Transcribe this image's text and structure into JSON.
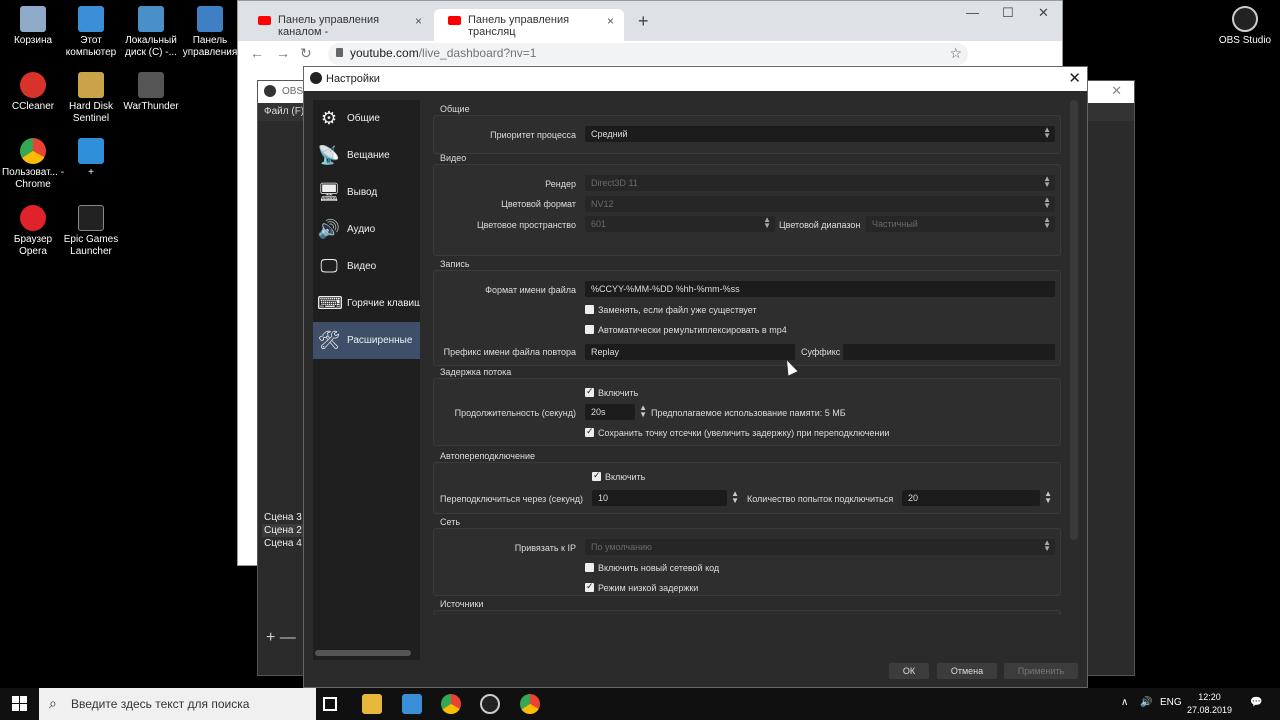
{
  "desktop": {
    "icons_left": [
      {
        "label": "Корзина",
        "color": "#8fa9c9"
      },
      {
        "label": "Этот компьютер",
        "color": "#3b8fd8"
      },
      {
        "label": "Локальный диск (C) -...",
        "color": "#4a90c8"
      },
      {
        "label": "Панель управления",
        "color": "#3f7fc4"
      },
      {
        "label": "CCleaner",
        "color": "#d8332a"
      },
      {
        "label": "Hard Disk Sentinel",
        "color": "#c9a24a"
      },
      {
        "label": "WarThunder",
        "color": "#555555"
      },
      {
        "label": "Пользоват... - Chrome",
        "color": "#4caf50"
      },
      {
        "label": "+",
        "color": "#2f8fd8"
      },
      {
        "label": "Браузер Opera",
        "color": "#e0222a"
      },
      {
        "label": "Epic Games Launcher",
        "color": "#222222"
      }
    ],
    "icon_right": {
      "label": "OBS Studio"
    }
  },
  "chrome": {
    "tabs": [
      {
        "title": "Панель управления каналом - ",
        "close": "×"
      },
      {
        "title": "Панель управления трансляц",
        "close": "×"
      }
    ],
    "new_tab": "+",
    "url_host": "youtube.com",
    "url_path": "/live_dashboard?nv=1",
    "min": "—",
    "max": "☐",
    "close": "✕"
  },
  "obs_main": {
    "title": "OBS",
    "menu": "Файл (F)",
    "scenes": [
      "Сцена 3",
      "Сцена 2",
      "Сцена 4"
    ],
    "add": "+ —"
  },
  "settings": {
    "title": "Настройки",
    "sidebar": [
      {
        "label": "Общие",
        "icon": "gear-icon",
        "glyph": "⚙"
      },
      {
        "label": "Вещание",
        "icon": "broadcast-icon",
        "glyph": "📡"
      },
      {
        "label": "Вывод",
        "icon": "output-icon",
        "glyph": "🖥"
      },
      {
        "label": "Аудио",
        "icon": "speaker-icon",
        "glyph": "🔊"
      },
      {
        "label": "Видео",
        "icon": "monitor-icon",
        "glyph": "🖵"
      },
      {
        "label": "Горячие клавиши",
        "icon": "keyboard-icon",
        "glyph": "⌨"
      },
      {
        "label": "Расширенные",
        "icon": "tools-icon",
        "glyph": "🛠"
      }
    ],
    "general": {
      "title": "Общие",
      "priority_label": "Приоритет процесса",
      "priority_value": "Средний"
    },
    "video": {
      "title": "Видео",
      "renderer_label": "Рендер",
      "renderer_value": "Direct3D 11",
      "color_format_label": "Цветовой формат",
      "color_format_value": "NV12",
      "color_space_label": "Цветовое пространство",
      "color_space_value": "601",
      "color_range_label": "Цветовой диапазон",
      "color_range_value": "Частичный"
    },
    "recording": {
      "title": "Запись",
      "filename_label": "Формат имени файла",
      "filename_value": "%CCYY-%MM-%DD %hh-%mm-%ss",
      "overwrite_label": "Заменять, если файл уже существует",
      "remux_label": "Автоматически ремультиплексировать в mp4",
      "replay_prefix_label": "Префикс имени файла повтора",
      "replay_prefix_value": "Replay",
      "suffix_label": "Суффикс",
      "suffix_value": ""
    },
    "stream_delay": {
      "title": "Задержка потока",
      "enable_label": "Включить",
      "duration_label": "Продолжительность (секунд)",
      "duration_value": "20s",
      "memory_note": "Предполагаемое использование памяти: 5 МБ",
      "preserve_label": "Сохранить точку отсечки (увеличить задержку) при переподключении"
    },
    "reconnect": {
      "title": "Автопереподключение",
      "enable_label": "Включить",
      "delay_label": "Переподключиться через (секунд)",
      "delay_value": "10",
      "retries_label": "Количество попыток подключиться",
      "retries_value": "20"
    },
    "network": {
      "title": "Сеть",
      "bind_label": "Привязать к IP",
      "bind_value": "По умолчанию",
      "new_net_label": "Включить новый сетевой код",
      "low_latency_label": "Режим низкой задержки"
    },
    "sources": {
      "title": "Источники"
    },
    "buttons": {
      "ok": "ОК",
      "cancel": "Отмена",
      "apply": "Применить"
    }
  },
  "taskbar": {
    "search_placeholder": "Введите здесь текст для поиска",
    "lang": "ENG",
    "time": "12:20",
    "date": "27.08.2019"
  }
}
